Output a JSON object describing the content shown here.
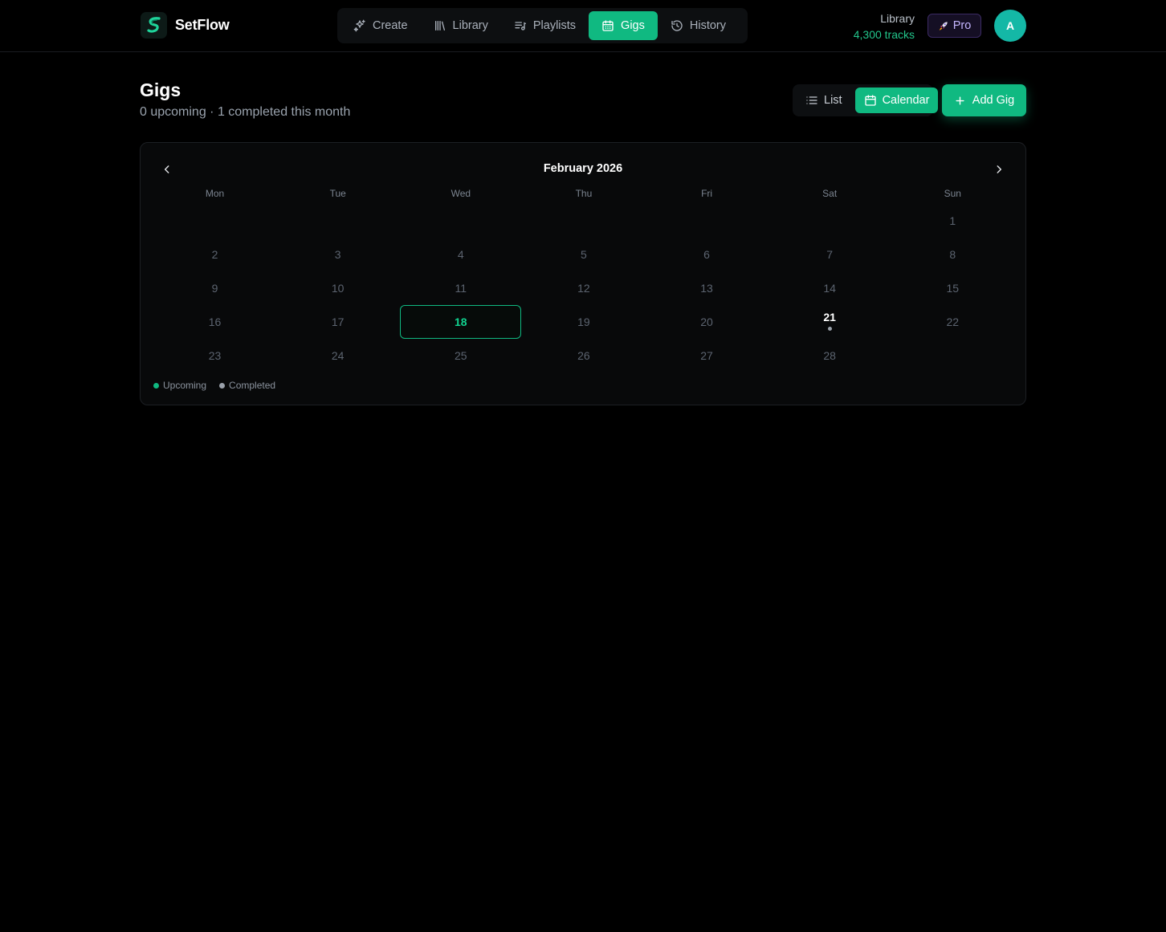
{
  "app": {
    "name": "SetFlow"
  },
  "nav": {
    "tabs": [
      {
        "label": "Create",
        "icon": "sparkles-icon"
      },
      {
        "label": "Library",
        "icon": "library-icon"
      },
      {
        "label": "Playlists",
        "icon": "playlist-icon"
      },
      {
        "label": "Gigs",
        "icon": "calendar-icon",
        "active": true
      },
      {
        "label": "History",
        "icon": "history-icon"
      }
    ]
  },
  "library_stat": {
    "label": "Library",
    "value": "4,300 tracks"
  },
  "pro_badge": {
    "label": "Pro",
    "icon": "rocket-icon"
  },
  "user": {
    "initial": "A"
  },
  "page": {
    "title": "Gigs",
    "subtitle": "0 upcoming · 1 completed this month"
  },
  "view_toggle": {
    "list_label": "List",
    "calendar_label": "Calendar",
    "selected": "Calendar"
  },
  "add_gig_label": "Add Gig",
  "calendar": {
    "month_label": "February 2026",
    "weekdays": [
      "Mon",
      "Tue",
      "Wed",
      "Thu",
      "Fri",
      "Sat",
      "Sun"
    ],
    "leading_blanks": 6,
    "days_in_month": 28,
    "today": 18,
    "completed_days": [
      21
    ],
    "upcoming_days": []
  },
  "legend": {
    "upcoming_label": "Upcoming",
    "completed_label": "Completed"
  },
  "colors": {
    "accent": "#10b981",
    "upcoming_dot": "#10b981",
    "completed_dot": "#9aa1aa",
    "pro_text": "#c4b5fd",
    "avatar_bg": "#14b8a6"
  }
}
